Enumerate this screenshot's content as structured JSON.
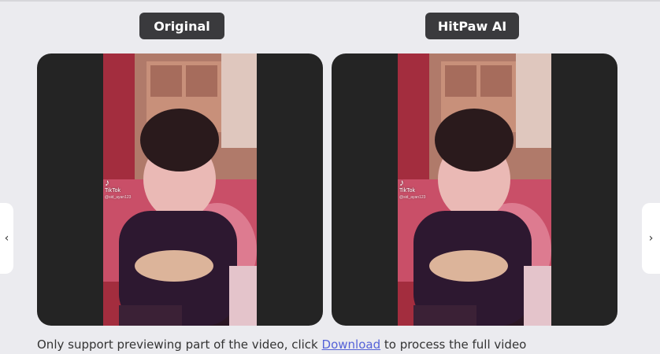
{
  "labels": {
    "original": "Original",
    "hitpaw": "HitPaw AI"
  },
  "video": {
    "watermark_logo": "♪",
    "watermark_brand": "TikTok",
    "watermark_handle": "@sid_ayan123"
  },
  "nav": {
    "prev_icon": "‹",
    "next_icon": "›"
  },
  "note": {
    "prefix": "Only support previewing part of the video, click",
    "link": "Download",
    "suffix": "to process the full video"
  },
  "colors": {
    "background": "#ebebef",
    "label_bg": "#3a3a3d",
    "panel_bg": "#242424",
    "link": "#5562d8"
  }
}
